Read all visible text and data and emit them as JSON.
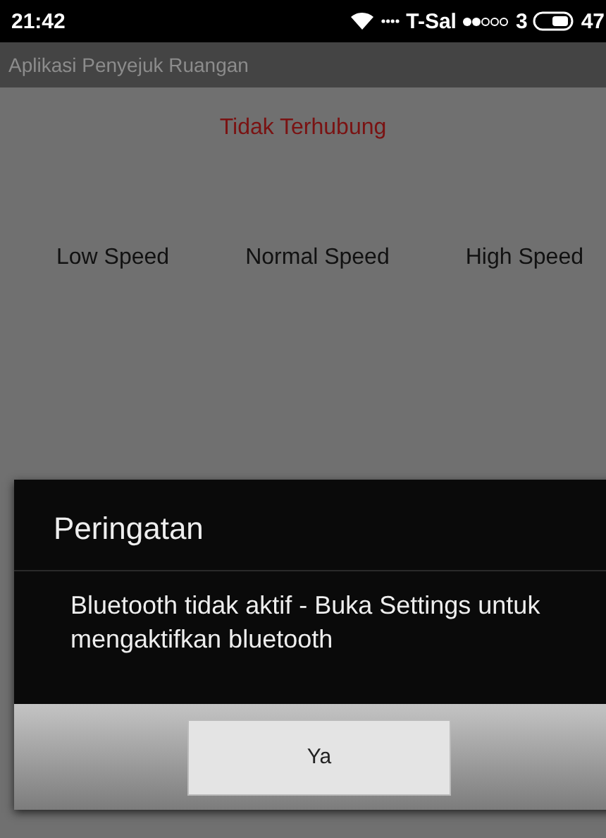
{
  "status_bar": {
    "time": "21:42",
    "carrier": "T-Sal",
    "network": "3",
    "battery": "47"
  },
  "app_bar": {
    "title": "Aplikasi Penyejuk Ruangan"
  },
  "connection_status": "Tidak Terhubung",
  "speed_buttons": [
    {
      "label": "Low Speed"
    },
    {
      "label": "Normal Speed"
    },
    {
      "label": "High Speed"
    }
  ],
  "dialog": {
    "title": "Peringatan",
    "message": "Bluetooth tidak aktif - Buka Settings untuk mengaktifkan bluetooth",
    "buttons": [
      "Ya"
    ]
  }
}
